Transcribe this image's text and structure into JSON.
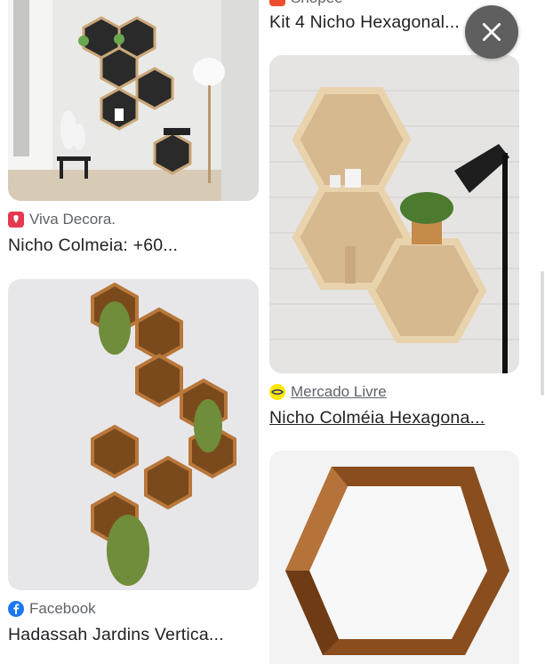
{
  "left_column": {
    "card1": {
      "source": "Viva Decora.",
      "source_icon": "viva-decora-favicon",
      "title": "Nicho Colmeia: +60..."
    },
    "card2": {
      "source": "Facebook",
      "source_icon": "facebook-favicon",
      "title": "Hadassah Jardins Vertica..."
    }
  },
  "right_column": {
    "card0": {
      "source": "Shopee",
      "title": "Kit 4 Nicho Hexagonal..."
    },
    "card1": {
      "source": "Mercado Livre",
      "source_icon": "mercado-livre-favicon",
      "title": "Nicho Colméia Hexagona..."
    }
  },
  "close_button": {
    "icon": "close-icon"
  },
  "colors": {
    "close_bg": "#5f5f5f",
    "text_primary": "#202124",
    "text_secondary": "#5f6368",
    "facebook_blue": "#1877f2",
    "viva_red": "#e53950"
  }
}
